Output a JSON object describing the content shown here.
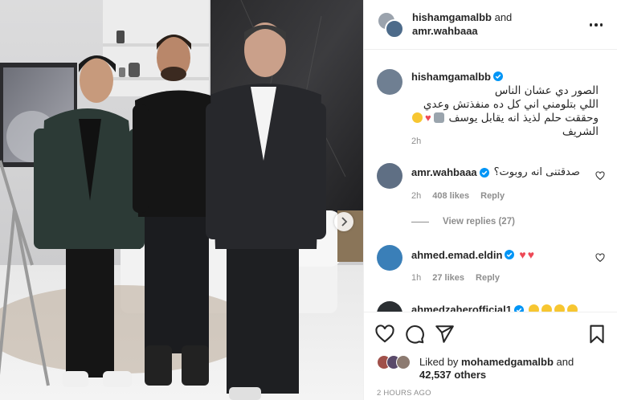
{
  "post": {
    "photo_alt": "photo",
    "next_icon": "chevron-right-icon"
  },
  "header": {
    "user1": "hishamgamalbb",
    "and": "and",
    "user2": "amr.wahbaaa",
    "more_icon": "ellipsis-icon"
  },
  "caption": {
    "username": "hishamgamalbb",
    "lines": [
      "الصور دي عشان الناس",
      "اللي بتلومني اني كل ده منفذتش وعدي",
      "وحققت حلم لذيذ انه يقابل يوسف الشريف"
    ],
    "time": "2h"
  },
  "comments": [
    {
      "username": "amr.wahbaaa",
      "text": "صدقتنى انه روبوت؟",
      "time": "2h",
      "likes": "408 likes",
      "reply": "Reply"
    },
    {
      "username": "ahmed.emad.eldin",
      "text": "",
      "time": "1h",
      "likes": "27 likes",
      "reply": "Reply"
    },
    {
      "username": "ahmedzaherofficial1",
      "text": ""
    }
  ],
  "view_replies": "View replies (27)",
  "likes": {
    "liked_by": "Liked by",
    "user": "mohamedgamalbb",
    "and": "and",
    "others": "42,537 others"
  },
  "timestamp": "2 HOURS AGO",
  "colors": {
    "verified": "#0095f6",
    "heart": "#ed4956",
    "muted": "#8e8e8e",
    "text": "#262626"
  }
}
